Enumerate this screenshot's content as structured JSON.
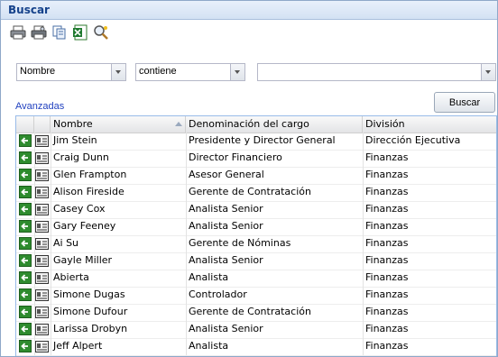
{
  "window": {
    "title": "Buscar"
  },
  "toolbar": {
    "icons": [
      "printer-icon",
      "print-preview-icon",
      "copy-icon",
      "excel-export-icon",
      "search-settings-icon"
    ]
  },
  "filter": {
    "field_value": "Nombre",
    "operator_value": "contiene",
    "text_value": ""
  },
  "advanced_label": "Avanzadas",
  "search_button": "Buscar",
  "grid": {
    "columns": [
      "Nombre",
      "Denominación del cargo",
      "División"
    ],
    "sort_column": "Nombre",
    "rows": [
      {
        "nombre": "Jim Stein",
        "cargo": "Presidente y Director General",
        "division": "Dirección Ejecutiva"
      },
      {
        "nombre": "Craig Dunn",
        "cargo": "Director Financiero",
        "division": "Finanzas"
      },
      {
        "nombre": "Glen Frampton",
        "cargo": "Asesor General",
        "division": "Finanzas"
      },
      {
        "nombre": "Alison Fireside",
        "cargo": "Gerente de Contratación",
        "division": "Finanzas"
      },
      {
        "nombre": "Casey Cox",
        "cargo": "Analista Senior",
        "division": "Finanzas"
      },
      {
        "nombre": "Gary Feeney",
        "cargo": "Analista Senior",
        "division": "Finanzas"
      },
      {
        "nombre": "Ai Su",
        "cargo": "Gerente de Nóminas",
        "division": "Finanzas"
      },
      {
        "nombre": "Gayle Miller",
        "cargo": "Analista Senior",
        "division": "Finanzas"
      },
      {
        "nombre": "Abierta",
        "cargo": "Analista",
        "division": "Finanzas"
      },
      {
        "nombre": "Simone Dugas",
        "cargo": "Controlador",
        "division": "Finanzas"
      },
      {
        "nombre": "Simone Dufour",
        "cargo": "Gerente de Contratación",
        "division": "Finanzas"
      },
      {
        "nombre": "Larissa Drobyn",
        "cargo": "Analista Senior",
        "division": "Finanzas"
      },
      {
        "nombre": "Jeff Alpert",
        "cargo": "Analista",
        "division": "Finanzas"
      }
    ]
  }
}
